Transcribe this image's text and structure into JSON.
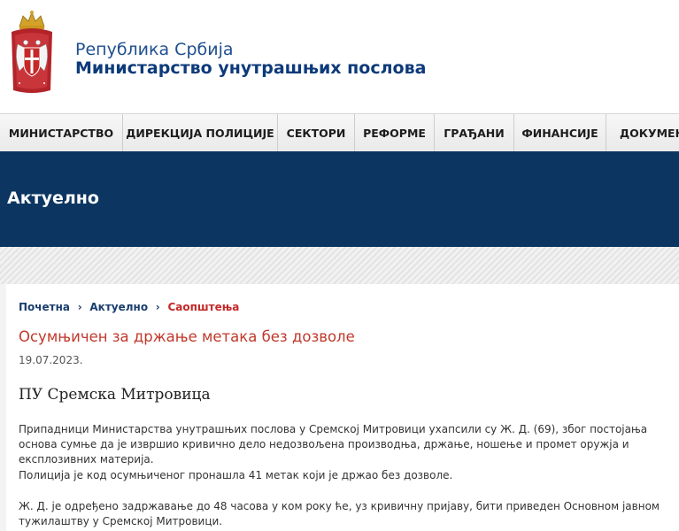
{
  "header": {
    "line1": "Република Србија",
    "line2": "Министарство унутрашњих послова",
    "logo": "coat-of-arms-of-serbia"
  },
  "nav": {
    "items": [
      {
        "label": "МИНИСТАРСТВО"
      },
      {
        "label": "ДИРЕКЦИЈА ПОЛИЦИЈЕ"
      },
      {
        "label": "СЕКТОРИ"
      },
      {
        "label": "РЕФОРМЕ"
      },
      {
        "label": "ГРАЂАНИ"
      },
      {
        "label": "ФИНАНСИЈЕ"
      },
      {
        "label": "ДОКУМЕНТ"
      }
    ]
  },
  "banner": {
    "title": "Актуелно"
  },
  "breadcrumb": {
    "items": [
      "Почетна",
      "Актуелно",
      "Саопштења"
    ]
  },
  "article": {
    "title": "Осумњичен за држање метака без дозволе",
    "date": "19.07.2023.",
    "unit": "ПУ Сремска Митровица",
    "paragraphs": [
      "Припадници Министарства унутрашњих послова у Сремској Митровици ухапсили су Ж. Д. (69), због постојања основа сумње да је извршио кривично дело недозвољена производња, држање, ношење и промет оружја и експлозивних материја.",
      "Полиција је код осумњиченог пронашла 41 метак који је држао без дозволе.",
      "Ж. Д. је одређено задржавање до 48 часова у ком року ће, уз кривичну пријаву, бити приведен Основном јавном тужилаштву у Сремској Митровици."
    ]
  },
  "colors": {
    "brand_blue": "#0c3661",
    "link_red": "#c62828",
    "title_red": "#c0392b"
  }
}
